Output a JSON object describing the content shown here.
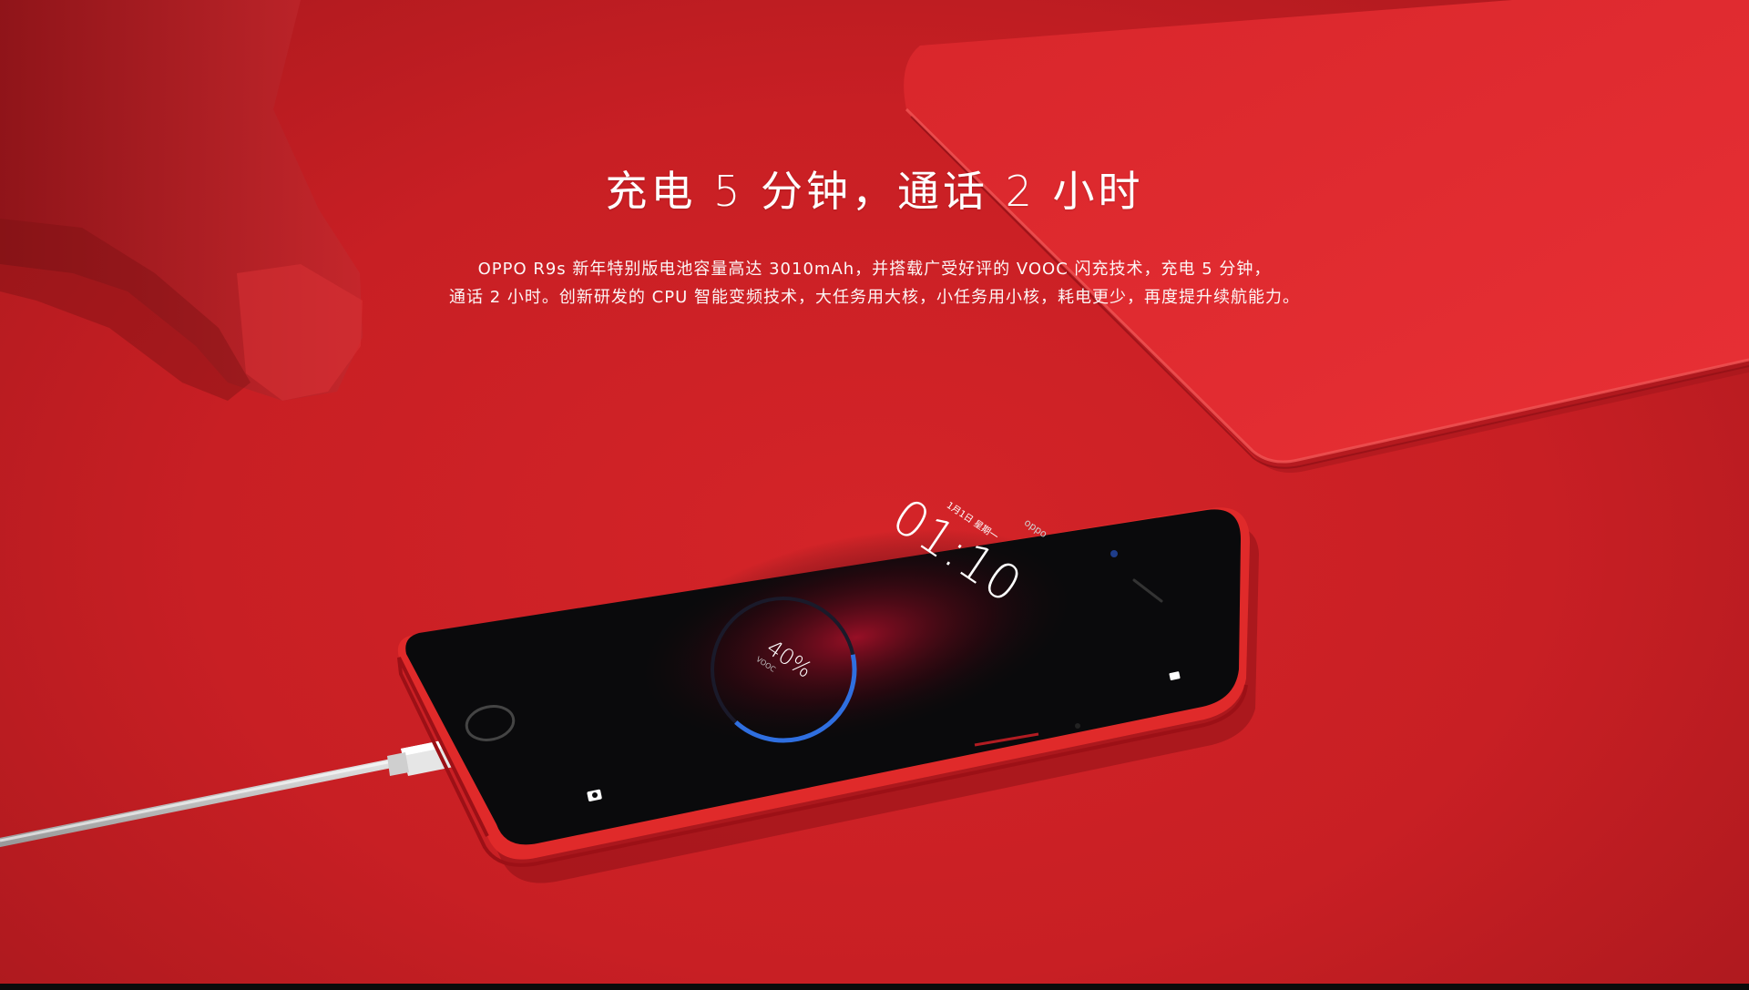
{
  "headline": "充电 5 分钟，通话 2 小时",
  "description": {
    "line1": "OPPO R9s 新年特别版电池容量高达 3010mAh，并搭载广受好评的 VOOC 闪充技术，充电 5 分钟，",
    "line2": "通话 2 小时。创新研发的 CPU 智能变频技术，大任务用大核，小任务用小核，耗电更少，再度提升续航能力。"
  },
  "phone_screen": {
    "brand": "oppo",
    "clock": "01:10",
    "date": "1月1日 星期一",
    "battery_percent": "40%",
    "charge_mode": "VOOC"
  },
  "colors": {
    "background": "#c81f24",
    "phone_body": "#e02a2a",
    "screen": "#0a0a0c",
    "charge_ring": "#2f6fe0",
    "text": "#ffffff"
  },
  "battery_level": 0.4
}
